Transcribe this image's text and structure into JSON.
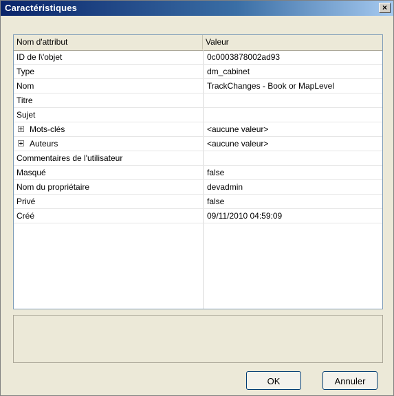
{
  "window": {
    "title": "Caractéristiques",
    "close_label": "×"
  },
  "table": {
    "headers": {
      "name": "Nom d'attribut",
      "value": "Valeur"
    },
    "rows": [
      {
        "name": "ID de l\\'objet",
        "value": "0c0003878002ad93",
        "expandable": false
      },
      {
        "name": "Type",
        "value": "dm_cabinet",
        "expandable": false
      },
      {
        "name": "Nom",
        "value": "TrackChanges - Book or MapLevel",
        "expandable": false
      },
      {
        "name": "Titre",
        "value": "",
        "expandable": false
      },
      {
        "name": "Sujet",
        "value": "",
        "expandable": false
      },
      {
        "name": "Mots-clés",
        "value": "<aucune valeur>",
        "expandable": true
      },
      {
        "name": "Auteurs",
        "value": "<aucune valeur>",
        "expandable": true
      },
      {
        "name": "Commentaires de l'utilisateur",
        "value": "",
        "expandable": false
      },
      {
        "name": "Masqué",
        "value": "false",
        "expandable": false
      },
      {
        "name": "Nom du propriétaire",
        "value": "devadmin",
        "expandable": false
      },
      {
        "name": "Privé",
        "value": "false",
        "expandable": false
      },
      {
        "name": "Créé",
        "value": "09/11/2010 04:59:09",
        "expandable": false
      }
    ]
  },
  "buttons": {
    "ok": "OK",
    "cancel": "Annuler"
  }
}
